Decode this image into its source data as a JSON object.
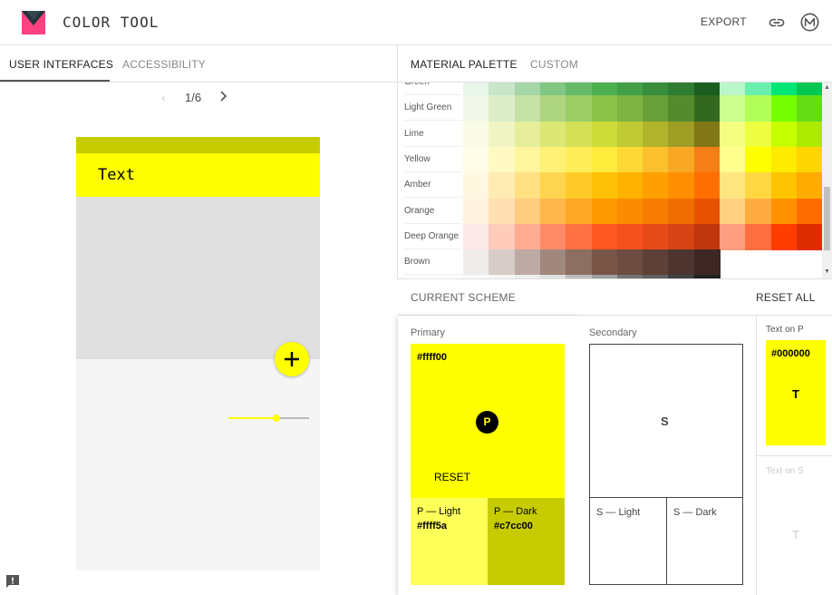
{
  "header": {
    "title": "COLOR TOOL",
    "export_label": "EXPORT"
  },
  "left_tabs": {
    "user_interfaces": "USER INTERFACES",
    "accessibility": "ACCESSIBILITY"
  },
  "pager": {
    "label": "1/6"
  },
  "phone": {
    "appbar_text": "Text",
    "slider_value": 0.6
  },
  "right_tabs": {
    "material_palette": "MATERIAL PALETTE",
    "custom": "CUSTOM"
  },
  "palette": {
    "names": [
      "Green",
      "Light Green",
      "Lime",
      "Yellow",
      "Amber",
      "Orange",
      "Deep Orange",
      "Brown"
    ],
    "rows": [
      [
        "#e8f5e9",
        "#c8e6c9",
        "#a5d6a7",
        "#81c784",
        "#66bb6a",
        "#4caf50",
        "#43a047",
        "#388e3c",
        "#2e7d32",
        "#1b5e20",
        "#b9f6ca",
        "#69f0ae",
        "#00e676",
        "#00c853"
      ],
      [
        "#f1f8e9",
        "#dcedc8",
        "#c5e1a5",
        "#aed581",
        "#9ccc65",
        "#8bc34a",
        "#7cb342",
        "#689f38",
        "#558b2f",
        "#33691e",
        "#ccff90",
        "#b2ff59",
        "#76ff03",
        "#64dd17"
      ],
      [
        "#f9fbe7",
        "#f0f4c3",
        "#e6ee9c",
        "#dce775",
        "#d4e157",
        "#cddc39",
        "#c0ca33",
        "#afb42b",
        "#9e9d24",
        "#827717",
        "#f4ff81",
        "#eeff41",
        "#c6ff00",
        "#aeea00"
      ],
      [
        "#fffde7",
        "#fff9c4",
        "#fff59d",
        "#fff176",
        "#ffee58",
        "#ffeb3b",
        "#fdd835",
        "#fbc02d",
        "#f9a825",
        "#f57f17",
        "#ffff8d",
        "#ffff00",
        "#ffea00",
        "#ffd600"
      ],
      [
        "#fff8e1",
        "#ffecb3",
        "#ffe082",
        "#ffd54f",
        "#ffca28",
        "#ffc107",
        "#ffb300",
        "#ffa000",
        "#ff8f00",
        "#ff6f00",
        "#ffe57f",
        "#ffd740",
        "#ffc400",
        "#ffab00"
      ],
      [
        "#fff3e0",
        "#ffe0b2",
        "#ffcc80",
        "#ffb74d",
        "#ffa726",
        "#ff9800",
        "#fb8c00",
        "#f57c00",
        "#ef6c00",
        "#e65100",
        "#ffd180",
        "#ffab40",
        "#ff9100",
        "#ff6d00"
      ],
      [
        "#fbe9e7",
        "#ffccbc",
        "#ffab91",
        "#ff8a65",
        "#ff7043",
        "#ff5722",
        "#f4511e",
        "#e64a19",
        "#d84315",
        "#bf360c",
        "#ff9e80",
        "#ff6e40",
        "#ff3d00",
        "#dd2c00"
      ],
      [
        "#efebe9",
        "#d7ccc8",
        "#bcaaa4",
        "#a1887f",
        "#8d6e63",
        "#795548",
        "#6d4c41",
        "#5d4037",
        "#4e342e",
        "#3e2723"
      ],
      [
        "#fafafa",
        "#f5f5f5",
        "#eeeeee",
        "#e0e0e0",
        "#bdbdbd",
        "#9e9e9e",
        "#757575",
        "#616161",
        "#424242",
        "#212121"
      ]
    ]
  },
  "scheme": {
    "title": "CURRENT SCHEME",
    "reset_all": "RESET ALL",
    "primary": {
      "label": "Primary",
      "hex": "#ffff00",
      "letter": "P",
      "reset": "RESET",
      "light_name": "P — Light",
      "light_hex": "#ffff5a",
      "dark_name": "P — Dark",
      "dark_hex": "#c7cc00"
    },
    "secondary": {
      "label": "Secondary",
      "letter": "S",
      "light_name": "S — Light",
      "dark_name": "S — Dark"
    },
    "text": {
      "on_p_label": "Text on P",
      "on_p_hex": "#000000",
      "on_p_letter": "T",
      "on_s_label": "Text on S",
      "on_s_letter": "T"
    }
  },
  "colors": {
    "primary": "#ffff00",
    "primary_light": "#ffff5a",
    "primary_dark": "#c7cc00"
  }
}
